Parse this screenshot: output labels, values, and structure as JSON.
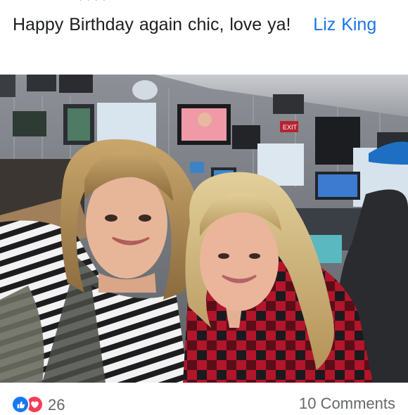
{
  "post": {
    "message": "Happy Birthday again chic, love ya!",
    "mention": "Liz King"
  },
  "photo": {
    "description_icon": "photo-icon",
    "exit_sign": "EXIT"
  },
  "footer": {
    "reaction_count": "26",
    "comments_label": "10 Comments",
    "reaction_icons": [
      "like-icon",
      "love-icon"
    ]
  },
  "colors": {
    "link": "#1b74e4",
    "like": "#1877f2",
    "love": "#f33e58",
    "muted": "#65676b"
  }
}
